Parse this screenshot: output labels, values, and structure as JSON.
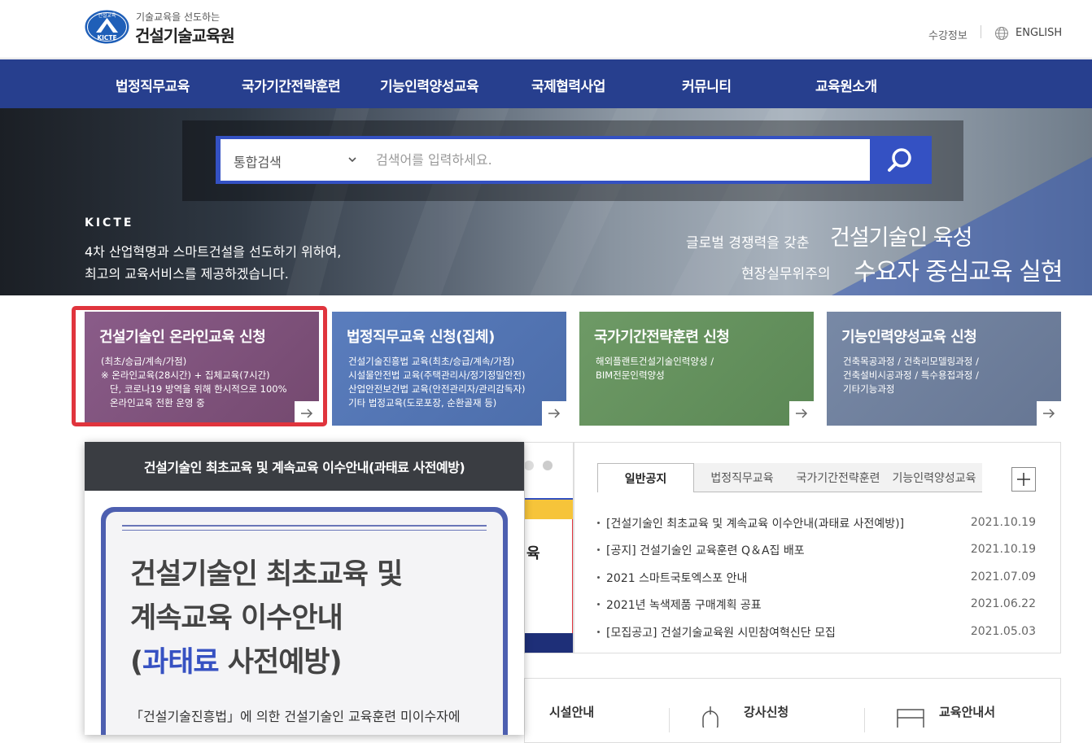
{
  "header": {
    "logo_text_sub": "기술교육을 선도하는",
    "logo_text_main": "건설기술교육원",
    "emblem_text_top": "건설교육",
    "emblem_text_bottom": "KICTE",
    "util_enroll": "수강정보",
    "util_english": "ENGLISH"
  },
  "nav": {
    "items": [
      "법정직무교육",
      "국가기간전략훈련",
      "기능인력양성교육",
      "국제협력사업",
      "커뮤니티",
      "교육원소개"
    ]
  },
  "search": {
    "select_value": "통합검색",
    "placeholder": "검색어를 입력하세요."
  },
  "hero": {
    "tag": "KICTE",
    "desc_line1": "4차 산업혁명과 스마트건설을 선도하기 위하여,",
    "desc_line2": "최고의 교육서비스를 제공하겠습니다.",
    "slogan1_small": "글로벌 경쟁력을 갖춘",
    "slogan1_big": "건설기술인 육성",
    "slogan2_small": "현장실무위주의",
    "slogan2_big": "수요자 중심교육 실현"
  },
  "cards": [
    {
      "title": "건설기술인 온라인교육 신청",
      "lines": [
        "(최초/승급/계속/가점)",
        "※ 온라인교육(28시간) + 집체교육(7시간)",
        "   단, 코로나19 방역을 위해 한시적으로 100%",
        "   온라인교육 전환 운영 중"
      ]
    },
    {
      "title": "법정직무교육 신청(집체)",
      "lines": [
        "건설기술진흥법 교육(최초/승급/계속/가점)",
        "시설물안전법 교육(주택관리사/정기정밀안전)",
        "산업안전보건법 교육(안전관리자/관리감독자)",
        "기타 법정교육(도로포장, 순환골재 등)"
      ]
    },
    {
      "title": "국가기간전략훈련 신청",
      "lines": [
        "해외플랜트건설기술인력양성 /",
        "BIM전문인력양성"
      ]
    },
    {
      "title": "기능인력양성교육 신청",
      "lines": [
        "건축목공과정 / 건축리모델링과정 /",
        "건축설비시공과정 / 특수용접과정 /",
        "기타기능과정"
      ]
    }
  ],
  "colors": {
    "nav_bg": "#273f8e",
    "search_blue": "#3451c3",
    "highlight_red": "#e0343d"
  },
  "popup": {
    "header": "건설기술인 최초교육 및 계속교육 이수안내(과태료 사전예방)",
    "poster_line1": "건설기술인 최초교육 및",
    "poster_line2": "계속교육 이수안내",
    "poster_line3_pre": "(",
    "poster_line3_highlight": "과태료",
    "poster_line3_post": " 사전예방)",
    "poster_sub": "「건설기술진흥법」에 의한 건설기술인 교육훈련 미이수자에"
  },
  "banner": {
    "partial_char": "육"
  },
  "notice": {
    "tabs": [
      "일반공지",
      "법정직무교육",
      "국가기간전략훈련",
      "기능인력양성교육"
    ],
    "items": [
      {
        "title": "[건설기술인 최초교육 및 계속교육 이수안내(과태료 사전예방)]",
        "date": "2021.10.19"
      },
      {
        "title": "[공지] 건설기술인 교육훈련 Q＆A집 배포",
        "date": "2021.10.19"
      },
      {
        "title": "2021 스마트국토엑스포 안내",
        "date": "2021.07.09"
      },
      {
        "title": "2021년 녹색제품 구매계획 공표",
        "date": "2021.06.22"
      },
      {
        "title": "[모집공고] 건설기술교육원 시민참여혁신단 모집",
        "date": "2021.05.03"
      }
    ]
  },
  "quick": {
    "items": [
      "시설안내",
      "강사신청",
      "교육안내서"
    ]
  }
}
